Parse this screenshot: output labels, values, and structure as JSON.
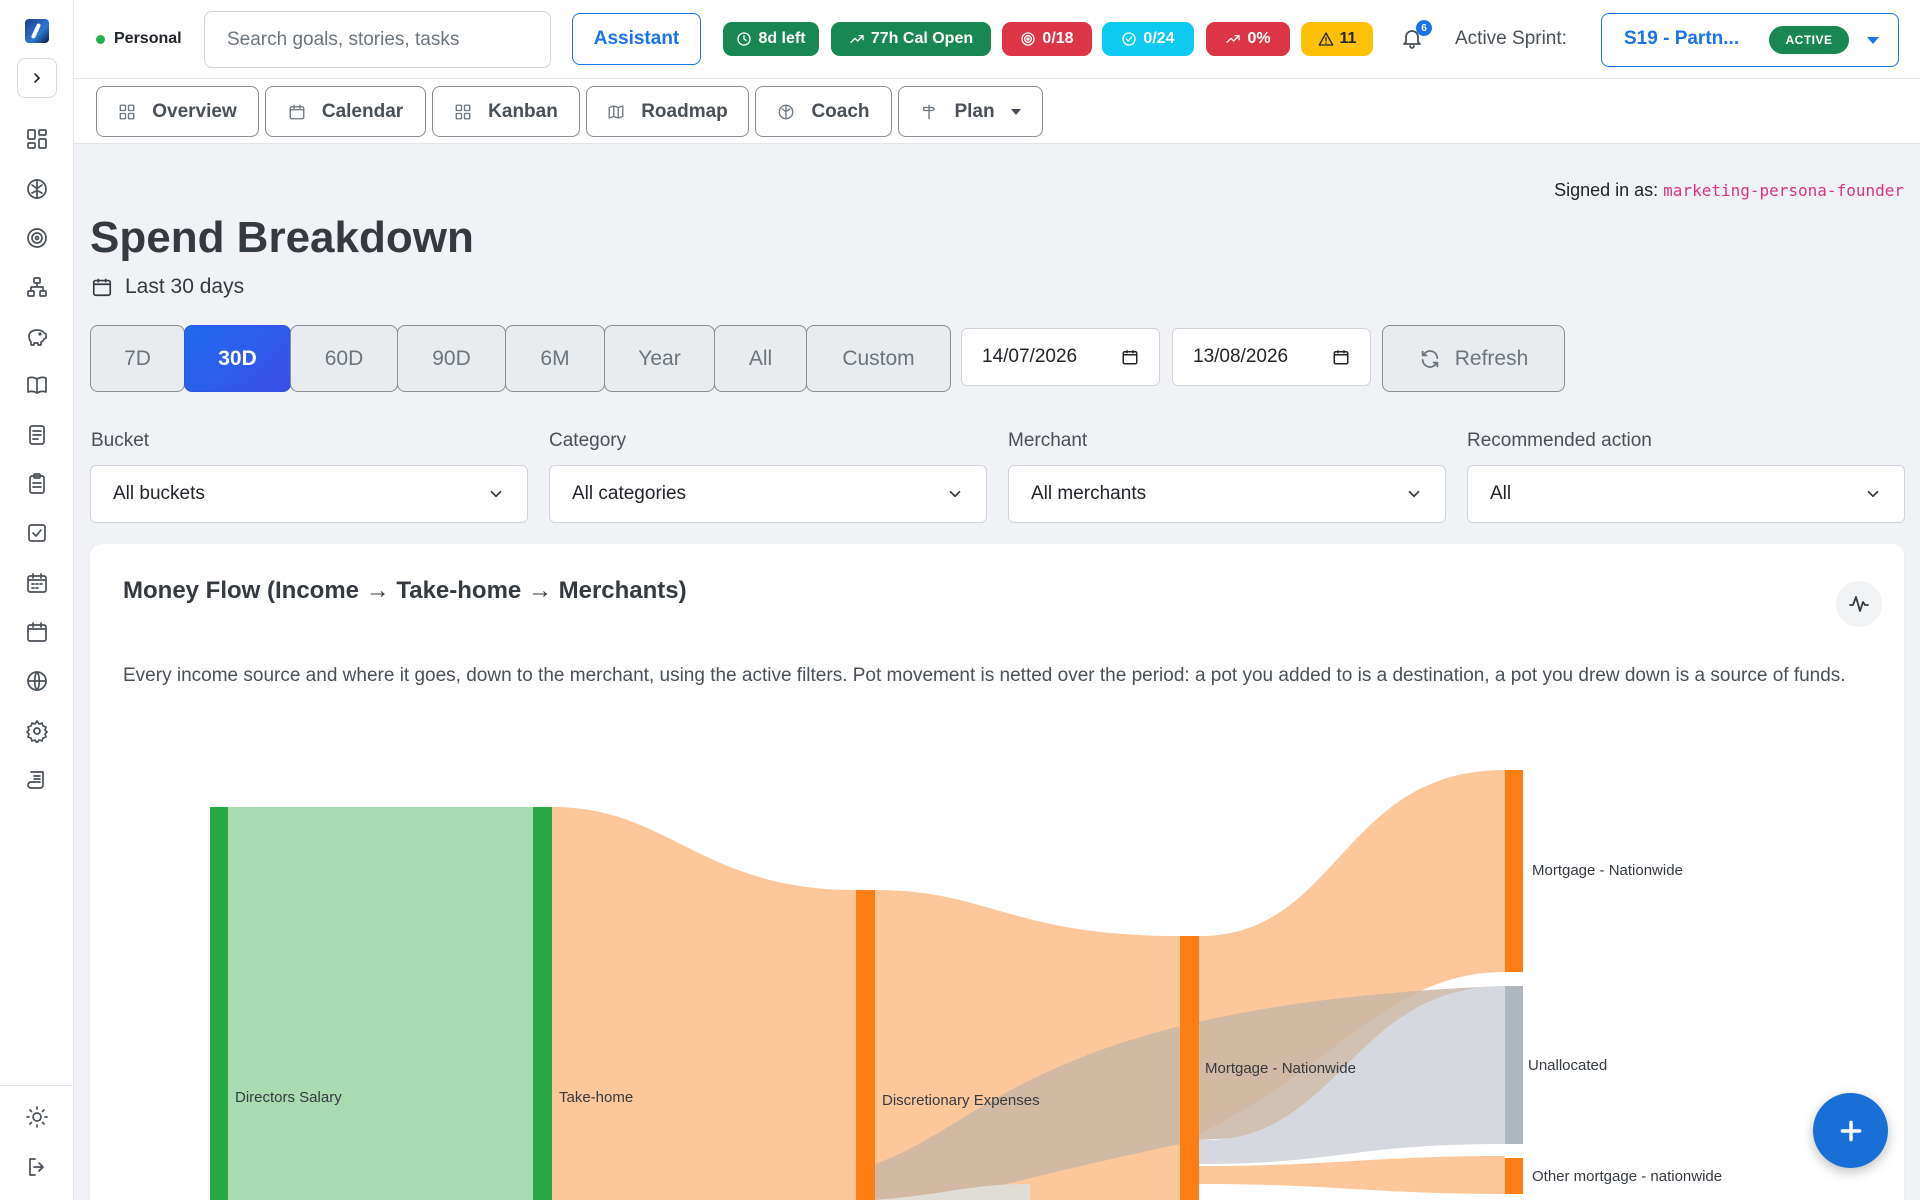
{
  "topbar": {
    "persona": "Personal",
    "search_placeholder": "Search goals, stories, tasks",
    "assistant_label": "Assistant",
    "pills": [
      {
        "icon": "clock-icon",
        "label": "8d left",
        "color": "#198754"
      },
      {
        "icon": "trend-up-icon",
        "label": "77h Cal Open",
        "color": "#198754"
      },
      {
        "icon": "target-icon",
        "label": "0/18",
        "color": "#dc3545"
      },
      {
        "icon": "check-circle-icon",
        "label": "0/24",
        "color": "#0dcaf0"
      },
      {
        "icon": "trend-up-icon",
        "label": "0%",
        "color": "#dc3545"
      },
      {
        "icon": "warning-icon",
        "label": "11",
        "color": "#ffc107"
      }
    ],
    "notifications_count": "6",
    "active_sprint_label": "Active Sprint:",
    "sprint_name": "S19 - Partn...",
    "sprint_status": "ACTIVE"
  },
  "nav": {
    "tabs": [
      {
        "label": "Overview",
        "icon": "dashboard-icon"
      },
      {
        "label": "Calendar",
        "icon": "calendar-icon"
      },
      {
        "label": "Kanban",
        "icon": "kanban-icon"
      },
      {
        "label": "Roadmap",
        "icon": "map-icon"
      },
      {
        "label": "Coach",
        "icon": "brain-icon"
      },
      {
        "label": "Plan",
        "icon": "signpost-icon"
      }
    ]
  },
  "main": {
    "signed_in_label": "Signed in as:",
    "signed_in_user": "marketing-persona-founder",
    "title": "Spend Breakdown",
    "range_text": "Last 30 days",
    "range_buttons": [
      "7D",
      "30D",
      "60D",
      "90D",
      "6M",
      "Year",
      "All",
      "Custom"
    ],
    "active_range": "30D",
    "start_date": "14/07/2026",
    "end_date": "13/08/2026",
    "refresh_label": "Refresh",
    "filters": [
      {
        "label": "Bucket",
        "value": "All buckets"
      },
      {
        "label": "Category",
        "value": "All categories"
      },
      {
        "label": "Merchant",
        "value": "All merchants"
      },
      {
        "label": "Recommended action",
        "value": "All"
      }
    ]
  },
  "card": {
    "title": "Money Flow (Income → Take-home → Merchants)",
    "description": "Every income source and where it goes, down to the merchant, using the active filters. Pot movement is netted over the period: a pot you added to is a destination, a pot you drew down is a source of funds."
  },
  "sankey": {
    "nodes": [
      {
        "name": "Directors Salary",
        "color": "#28a745"
      },
      {
        "name": "Take-home",
        "color": "#28a745"
      },
      {
        "name": "Discretionary Expenses",
        "color": "#fd7e14"
      },
      {
        "name": "Mortgage - Nationwide",
        "color": "#fd7e14"
      },
      {
        "name": "Mortgage - Nationwide",
        "color": "#fd7e14"
      },
      {
        "name": "Unallocated",
        "color": "#adb5bd"
      },
      {
        "name": "Other mortgage - nationwide",
        "color": "#fd7e14"
      }
    ],
    "link_colors": {
      "income": "#a8dcb0",
      "spend": "#fbc79b",
      "unallocated": "#d5d9df"
    }
  }
}
